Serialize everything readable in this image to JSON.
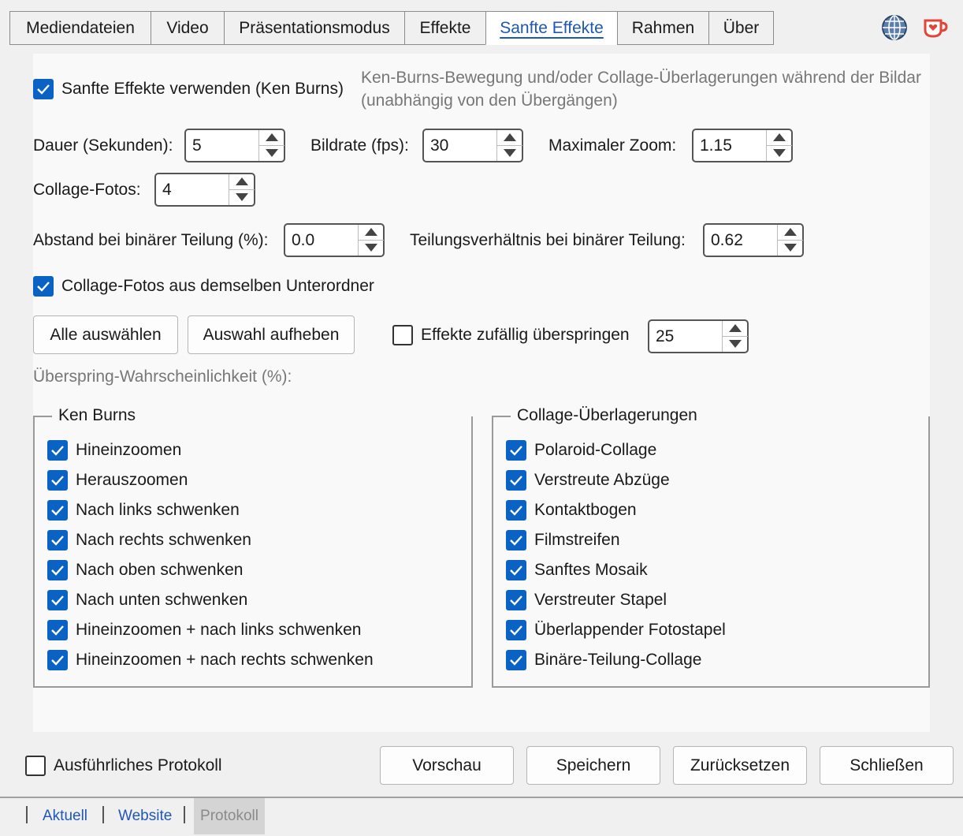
{
  "tabs": [
    {
      "label": "Mediendateien"
    },
    {
      "label": "Video"
    },
    {
      "label": "Präsentationsmodus"
    },
    {
      "label": "Effekte"
    },
    {
      "label": "Sanfte Effekte"
    },
    {
      "label": "Rahmen"
    },
    {
      "label": "Über"
    }
  ],
  "icons": {
    "globe": "globe-icon",
    "heart_cup": "coffee-heart-icon"
  },
  "colors": {
    "accent": "#0a63c4",
    "link": "#1f57b5"
  },
  "main": {
    "use_soft_effects": {
      "label": "Sanfte Effekte verwenden (Ken Burns)",
      "checked": true
    },
    "description_line1": "Ken-Burns-Bewegung und/oder Collage-Überlagerungen während der Bildar",
    "description_line2": "(unabhängig von den Übergängen)",
    "duration": {
      "label": "Dauer (Sekunden):",
      "value": "5"
    },
    "framerate": {
      "label": "Bildrate (fps):",
      "value": "30"
    },
    "max_zoom": {
      "label": "Maximaler Zoom:",
      "value": "1.15"
    },
    "collage_photos": {
      "label": "Collage-Fotos:",
      "value": "4"
    },
    "binary_gap": {
      "label": "Abstand bei binärer Teilung (%):",
      "value": "0.0"
    },
    "binary_ratio": {
      "label": "Teilungsverhältnis bei binärer Teilung:",
      "value": "0.62"
    },
    "same_folder": {
      "label": "Collage-Fotos aus demselben Unterordner",
      "checked": true
    },
    "select_all": "Alle auswählen",
    "deselect": "Auswahl aufheben",
    "skip_random": {
      "label": "Effekte zufällig überspringen",
      "checked": false,
      "value": "25"
    },
    "skip_prob_label": "Überspring-Wahrscheinlichkeit (%):"
  },
  "ken_burns": {
    "title": "Ken Burns",
    "items": [
      {
        "label": "Hineinzoomen",
        "checked": true
      },
      {
        "label": "Herauszoomen",
        "checked": true
      },
      {
        "label": "Nach links schwenken",
        "checked": true
      },
      {
        "label": "Nach rechts schwenken",
        "checked": true
      },
      {
        "label": "Nach oben schwenken",
        "checked": true
      },
      {
        "label": "Nach unten schwenken",
        "checked": true
      },
      {
        "label": "Hineinzoomen + nach links schwenken",
        "checked": true
      },
      {
        "label": "Hineinzoomen + nach rechts schwenken",
        "checked": true
      }
    ]
  },
  "collage": {
    "title": "Collage-Überlagerungen",
    "items": [
      {
        "label": "Polaroid-Collage",
        "checked": true
      },
      {
        "label": "Verstreute Abzüge",
        "checked": true
      },
      {
        "label": "Kontaktbogen",
        "checked": true
      },
      {
        "label": "Filmstreifen",
        "checked": true
      },
      {
        "label": "Sanftes Mosaik",
        "checked": true
      },
      {
        "label": "Verstreuter Stapel",
        "checked": true
      },
      {
        "label": "Überlappender Fotostapel",
        "checked": true
      },
      {
        "label": "Binäre-Teilung-Collage",
        "checked": true
      }
    ]
  },
  "bottom": {
    "verbose_log": {
      "label": "Ausführliches Protokoll",
      "checked": false
    },
    "preview": "Vorschau",
    "save": "Speichern",
    "reset": "Zurücksetzen",
    "close": "Schließen"
  },
  "footer": {
    "current": "Aktuell",
    "website": "Website",
    "log": "Protokoll"
  }
}
